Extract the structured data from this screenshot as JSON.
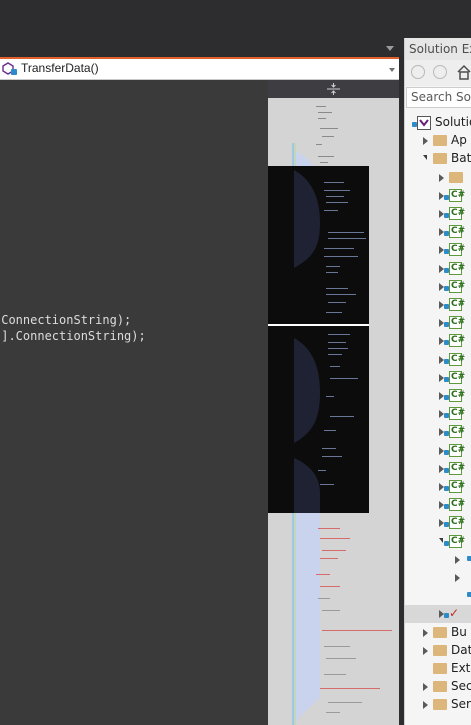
{
  "navbar": {
    "member_label": "TransferData()"
  },
  "editor": {
    "lines": [
      ".ConnectionString);",
      "\"].ConnectionString);"
    ]
  },
  "solution_explorer": {
    "title": "Solution Exp",
    "search_placeholder": "Search Solu",
    "tree": [
      {
        "label": "Solution",
        "icon": "solution-icon",
        "arrow": "none"
      },
      {
        "label": "Ap",
        "icon": "folder-icon",
        "arrow": "collapsed"
      },
      {
        "label": "Bat",
        "icon": "folder-icon",
        "arrow": "expanded"
      },
      {
        "label": "",
        "icon": "folder-icon",
        "arrow": "collapsed"
      },
      {
        "label": "C#",
        "icon": "cs-file-icon",
        "arrow": "collapsed"
      },
      {
        "label": "C#",
        "icon": "cs-file-icon",
        "arrow": "collapsed"
      },
      {
        "label": "C#",
        "icon": "cs-file-icon",
        "arrow": "collapsed"
      },
      {
        "label": "C#",
        "icon": "cs-file-icon",
        "arrow": "collapsed"
      },
      {
        "label": "C#",
        "icon": "cs-file-icon",
        "arrow": "collapsed"
      },
      {
        "label": "C#",
        "icon": "cs-file-icon",
        "arrow": "collapsed"
      },
      {
        "label": "C#",
        "icon": "cs-file-icon",
        "arrow": "collapsed"
      },
      {
        "label": "C#",
        "icon": "cs-file-icon",
        "arrow": "collapsed"
      },
      {
        "label": "C#",
        "icon": "cs-file-icon",
        "arrow": "collapsed"
      },
      {
        "label": "C#",
        "icon": "cs-file-icon",
        "arrow": "collapsed"
      },
      {
        "label": "C#",
        "icon": "cs-file-icon",
        "arrow": "collapsed"
      },
      {
        "label": "C#",
        "icon": "cs-file-icon",
        "arrow": "collapsed"
      },
      {
        "label": "C#",
        "icon": "cs-file-icon",
        "arrow": "collapsed"
      },
      {
        "label": "C#",
        "icon": "cs-file-icon",
        "arrow": "collapsed"
      },
      {
        "label": "C#",
        "icon": "cs-file-icon",
        "arrow": "collapsed"
      },
      {
        "label": "C#",
        "icon": "cs-file-icon",
        "arrow": "collapsed"
      },
      {
        "label": "C#",
        "icon": "cs-file-icon",
        "arrow": "collapsed"
      },
      {
        "label": "C#",
        "icon": "cs-file-icon",
        "arrow": "collapsed"
      },
      {
        "label": "C#",
        "icon": "cs-file-icon",
        "arrow": "collapsed"
      },
      {
        "label": "C#",
        "icon": "cs-file-icon",
        "arrow": "expanded"
      },
      {
        "label": "",
        "icon": "ref-icon",
        "arrow": "collapsed"
      },
      {
        "label": "",
        "icon": "item-icon",
        "arrow": "collapsed"
      },
      {
        "label": "",
        "icon": "ref-icon",
        "arrow": "none"
      },
      {
        "label": "",
        "icon": "check-icon",
        "arrow": "collapsed",
        "selected": true
      },
      {
        "label": "Bu",
        "icon": "folder-icon",
        "arrow": "collapsed"
      },
      {
        "label": "Dat",
        "icon": "folder-icon",
        "arrow": "collapsed"
      },
      {
        "label": "Ext",
        "icon": "folder-icon",
        "arrow": "none"
      },
      {
        "label": "Sec",
        "icon": "folder-icon",
        "arrow": "collapsed"
      },
      {
        "label": "Ser",
        "icon": "folder-icon",
        "arrow": "collapsed"
      }
    ]
  },
  "colors": {
    "accent_orange": "#e0602e",
    "map_highlight": "#c9d3f0",
    "map_text_red": "#d66b6b"
  }
}
